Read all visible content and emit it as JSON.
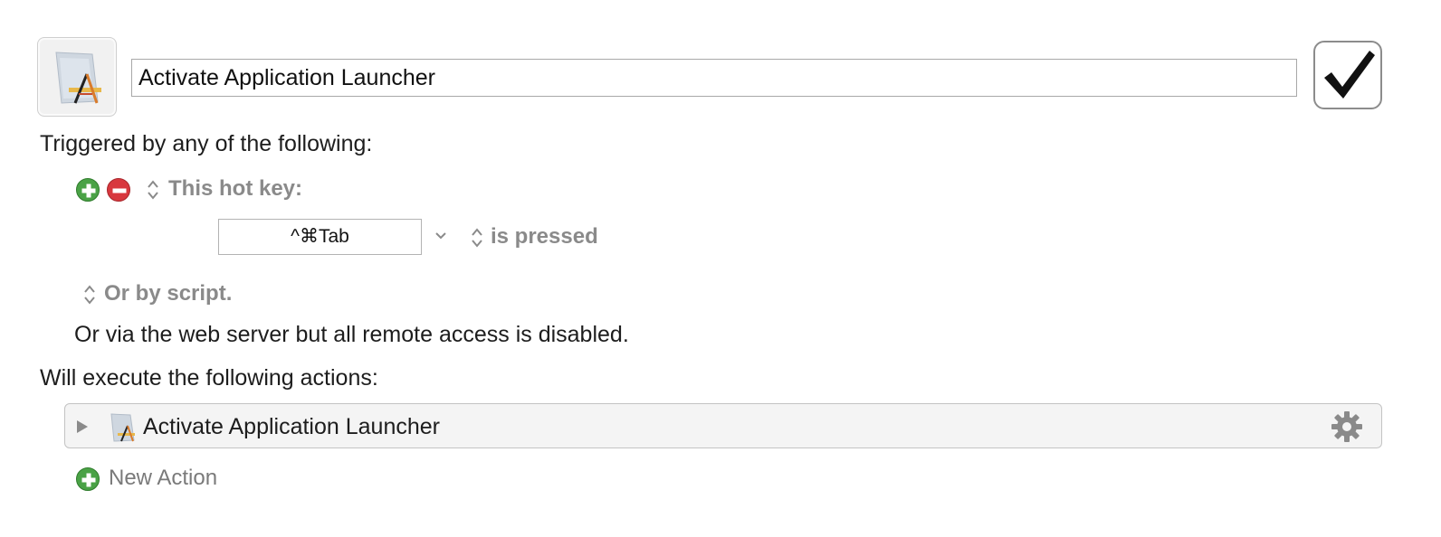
{
  "macro": {
    "name": "Activate Application Launcher",
    "enabled": true
  },
  "triggers": {
    "heading": "Triggered by any of the following:",
    "trigger_type": "This hot key:",
    "hotkey": "^⌘Tab",
    "hotkey_state": "is pressed",
    "script_option": "Or by script.",
    "webserver_note": "Or via the web server but all remote access is disabled."
  },
  "actions": {
    "heading": "Will execute the following actions:",
    "items": [
      {
        "title": "Activate Application Launcher"
      }
    ],
    "new_action_label": "New Action"
  },
  "colors": {
    "add_green": "#4aa246",
    "remove_red": "#d8383e",
    "secondary_text": "#8a8a8a"
  }
}
